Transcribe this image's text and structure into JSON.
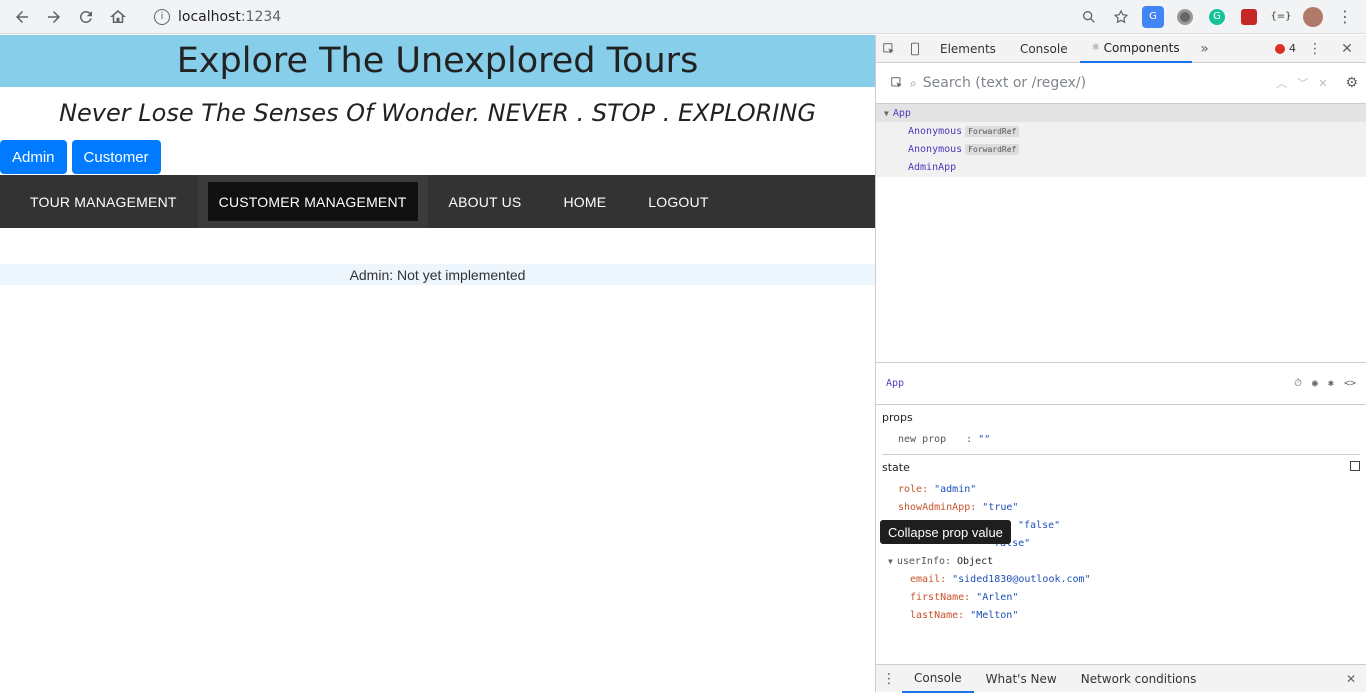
{
  "browser": {
    "url_host": "localhost",
    "url_port": ":1234"
  },
  "page": {
    "title": "Explore The Unexplored Tours",
    "tagline": "Never Lose The Senses Of Wonder. NEVER . STOP . EXPLORING",
    "role_buttons": [
      "Admin",
      "Customer"
    ],
    "nav": [
      "TOUR MANAGEMENT",
      "CUSTOMER MANAGEMENT",
      "ABOUT US",
      "HOME",
      "LOGOUT"
    ],
    "status_message": "Admin: Not yet implemented",
    "colors": {
      "banner": "#87ceeb",
      "navbar": "#333333",
      "button": "#007bff"
    }
  },
  "devtools": {
    "tabs": [
      "Elements",
      "Console",
      "Components"
    ],
    "active_tab": "Components",
    "error_count": "4",
    "search_placeholder": "Search (text or /regex/)",
    "tree": {
      "root": "App",
      "children": [
        {
          "name": "Anonymous",
          "badge": "ForwardRef"
        },
        {
          "name": "Anonymous",
          "badge": "ForwardRef"
        },
        {
          "name": "AdminApp",
          "badge": ""
        }
      ]
    },
    "selected": "App",
    "props": {
      "title": "props",
      "key": "new prop",
      "value": "\"\""
    },
    "state": {
      "title": "state",
      "role": "\"admin\"",
      "showAdminApp": "\"true\"",
      "hidden_value_1": "\"false\"",
      "hidden_value_2": "\"false\"",
      "userInfo_label": "Object",
      "email": "\"sided1830@outlook.com\"",
      "firstName": "\"Arlen\"",
      "lastName": "\"Melton\""
    },
    "tooltip": "Collapse prop value",
    "drawer_tabs": [
      "Console",
      "What's New",
      "Network conditions"
    ]
  }
}
